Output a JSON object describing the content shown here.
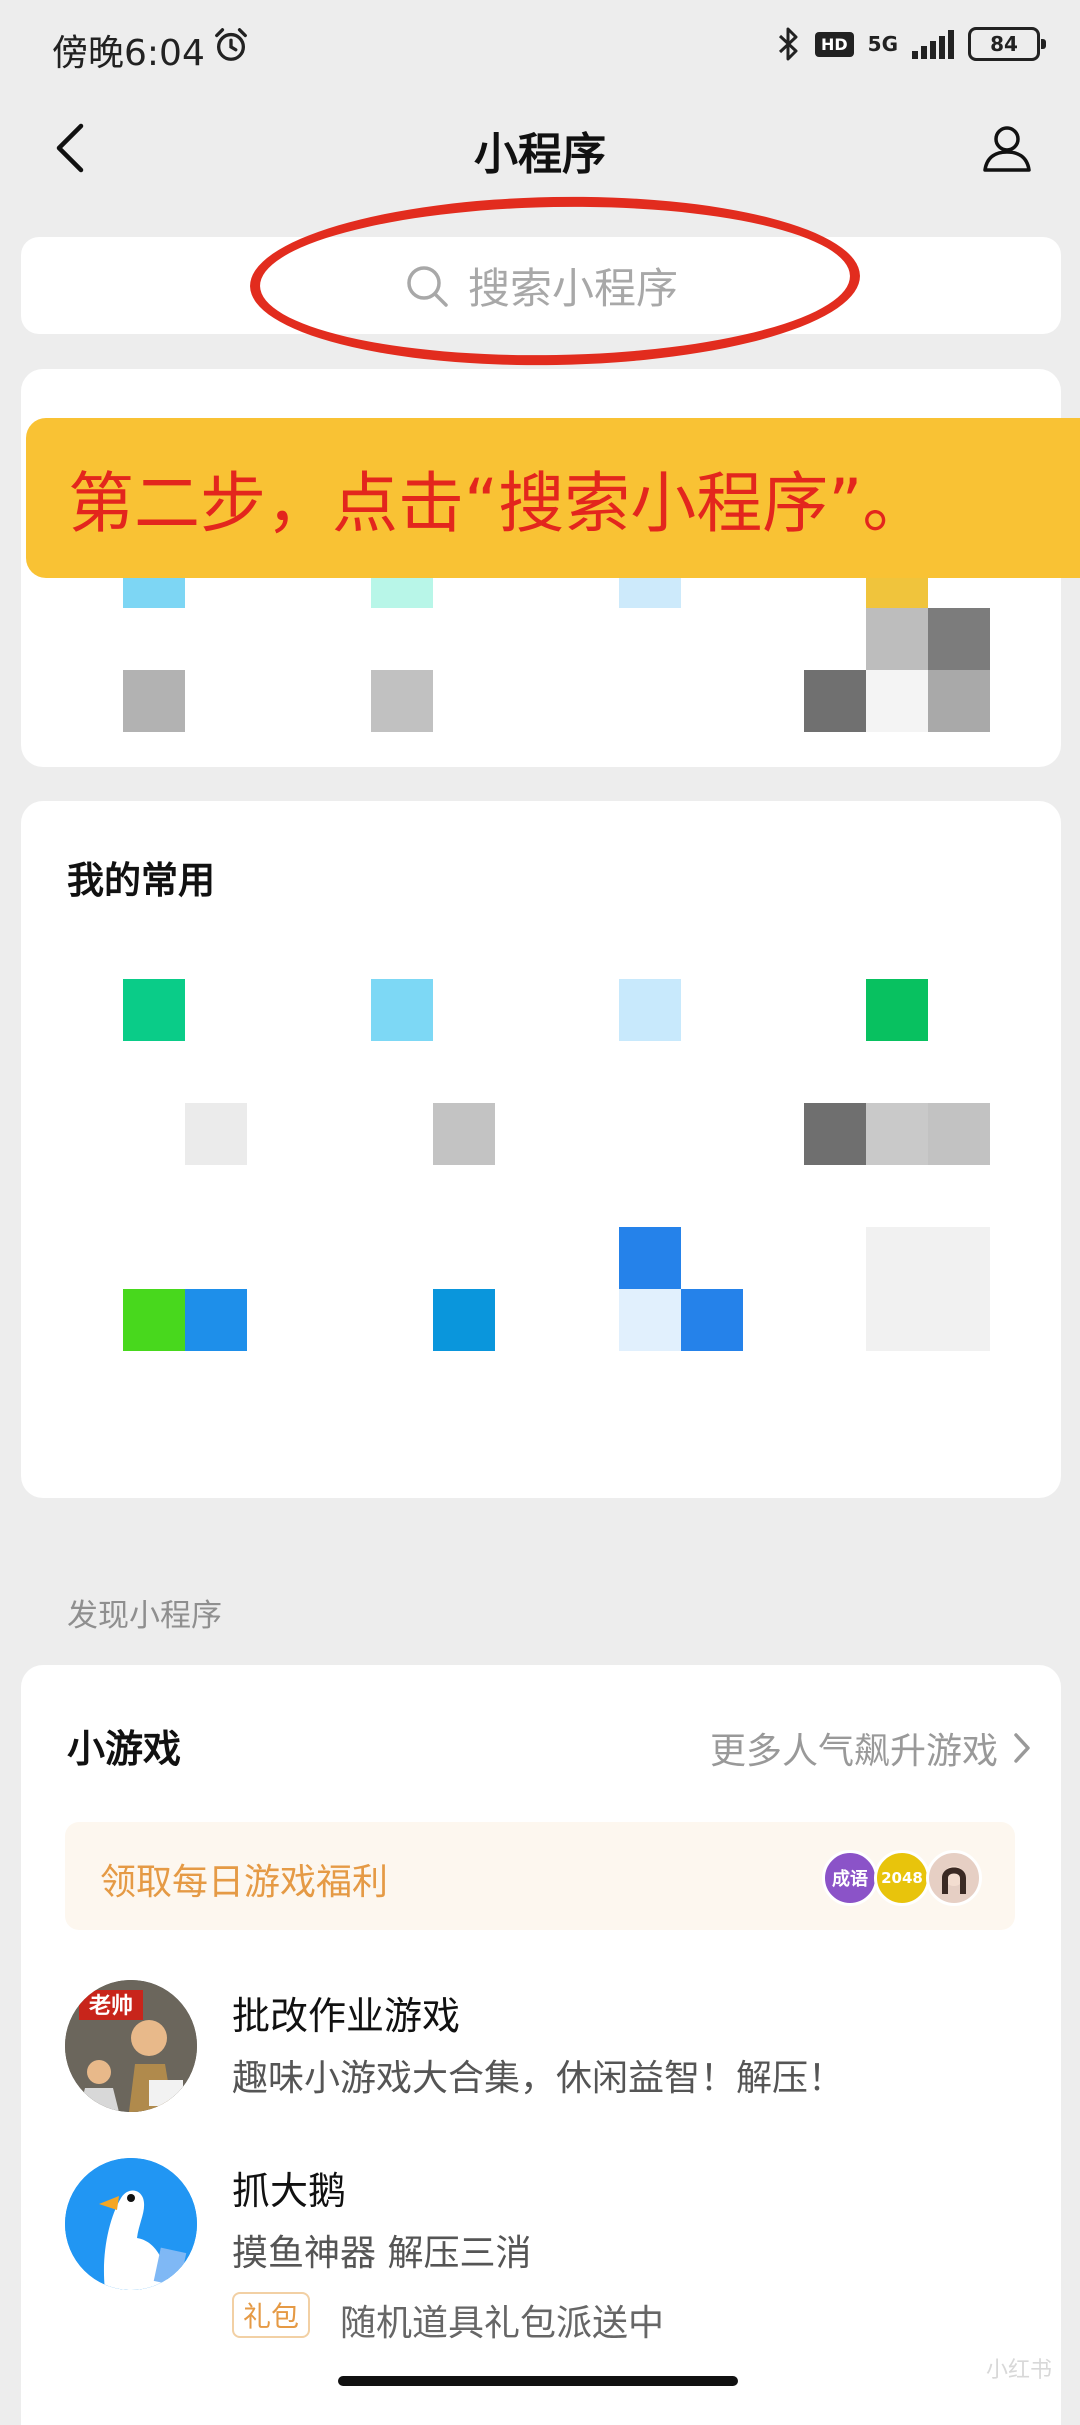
{
  "status_bar": {
    "time": "傍晚6:04",
    "network": "5G",
    "hd": "HD",
    "battery": "84"
  },
  "nav": {
    "title": "小程序"
  },
  "search": {
    "placeholder": "搜索小程序"
  },
  "banner": {
    "text": "第二步，点击“搜索小程序”。"
  },
  "common": {
    "title": "我的常用"
  },
  "discover": {
    "label": "发现小程序"
  },
  "games": {
    "title": "小游戏",
    "more": "更多人气飙升游戏",
    "welfare": "领取每日游戏福利",
    "welfare_avatars": [
      "成语",
      "2048",
      ""
    ],
    "items": [
      {
        "name": "批改作业游戏",
        "desc": "趣味小游戏大合集，休闲益智！解压！",
        "icon_text": "老帅"
      },
      {
        "name": "抓大鹅",
        "desc": "摸鱼神器 解压三消",
        "tag": "礼包",
        "tag_text": "随机道具礼包派送中"
      }
    ]
  },
  "watermark": "小红书"
}
